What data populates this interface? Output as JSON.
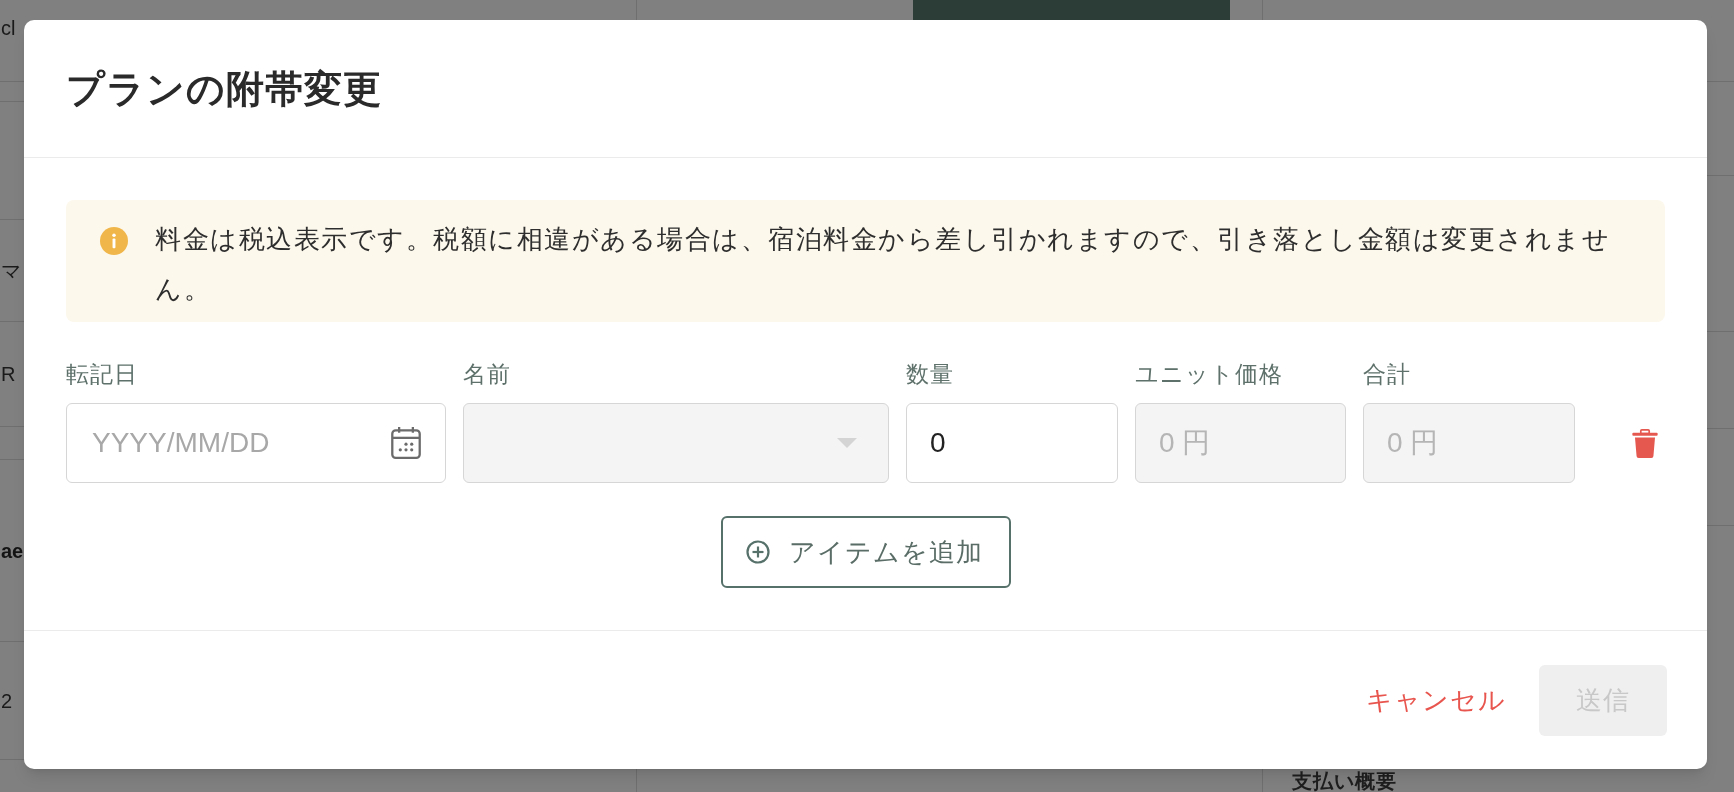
{
  "background": {
    "list_texts": [
      {
        "text": "cl",
        "kind": "plain"
      },
      {
        "text": "マ",
        "kind": "plain"
      },
      {
        "text": "R",
        "kind": "plain"
      },
      {
        "text": "ae",
        "kind": "bold"
      },
      {
        "text": "2",
        "kind": "plain"
      }
    ],
    "section_title": "支払い概要"
  },
  "dialog": {
    "title": "プランの附帯変更",
    "notice": "料金は税込表示です。税額に相違がある場合は、宿泊料金から差し引かれますので、引き落とし金額は変更されません。",
    "columns": [
      "転記日",
      "名前",
      "数量",
      "ユニット価格",
      "合計"
    ],
    "items": [
      {
        "date": {
          "placeholder": "YYYY/MM/DD",
          "disabled": false
        },
        "name": {
          "disabled": true
        },
        "quantity": {
          "value": "0",
          "disabled": false
        },
        "unit_price": {
          "value": "0 円",
          "disabled": true
        },
        "total": {
          "value": "0 円",
          "disabled": true
        }
      }
    ],
    "add_button": "アイテムを追加",
    "cancel_button": "キャンセル",
    "submit_button": {
      "label": "送信",
      "disabled": true
    }
  }
}
